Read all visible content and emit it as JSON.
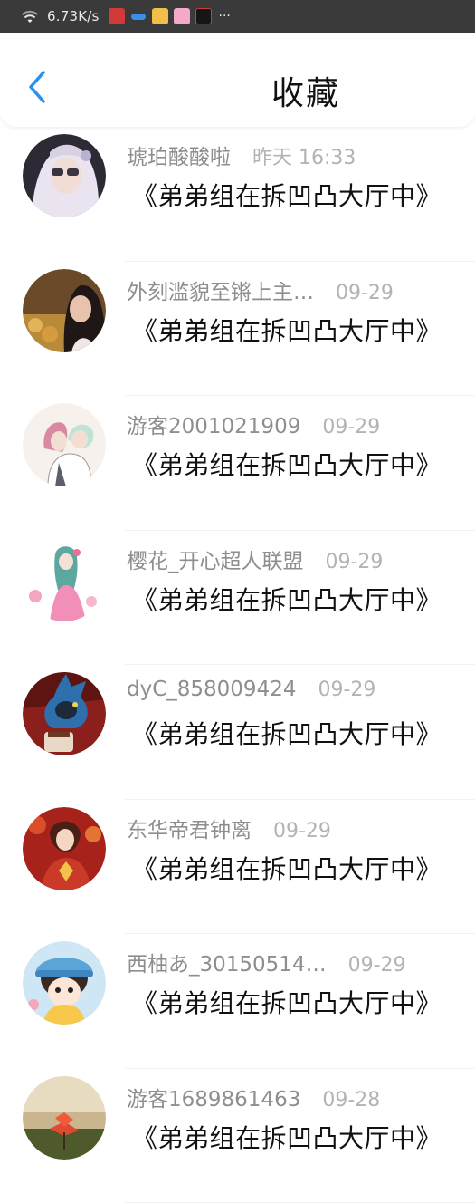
{
  "status_bar": {
    "net_speed": "6.73K/s",
    "more": "···"
  },
  "header": {
    "title": "收藏",
    "back_icon": "chevron-left-icon",
    "accent_color": "#2b8ff0"
  },
  "favorites": [
    {
      "username": "琥珀酸酸啦",
      "time": "昨天 16:33",
      "title": "《弟弟组在拆凹凸大厅中》",
      "avatar": "avatar-white-hair-girl"
    },
    {
      "username": "外刻滥貌至锵上主…",
      "time": "09-29",
      "title": "《弟弟组在拆凹凸大厅中》",
      "avatar": "avatar-photo-woman"
    },
    {
      "username": "游客2001021909",
      "time": "09-29",
      "title": "《弟弟组在拆凹凸大厅中》",
      "avatar": "avatar-anime-duo"
    },
    {
      "username": "樱花_开心超人联盟",
      "time": "09-29",
      "title": "《弟弟组在拆凹凸大厅中》",
      "avatar": "avatar-pink-dress-girl"
    },
    {
      "username": "dyC_858009424",
      "time": "09-29",
      "title": "《弟弟组在拆凹凸大厅中》",
      "avatar": "avatar-blue-creature-cup"
    },
    {
      "username": "东华帝君钟离",
      "time": "09-29",
      "title": "《弟弟组在拆凹凸大厅中》",
      "avatar": "avatar-red-anime-boy"
    },
    {
      "username": "西柚あ_30150514…",
      "time": "09-29",
      "title": "《弟弟组在拆凹凸大厅中》",
      "avatar": "avatar-chibi-blue-hat"
    },
    {
      "username": "游客1689861463",
      "time": "09-28",
      "title": "《弟弟组在拆凹凸大厅中》",
      "avatar": "avatar-red-flower"
    }
  ]
}
